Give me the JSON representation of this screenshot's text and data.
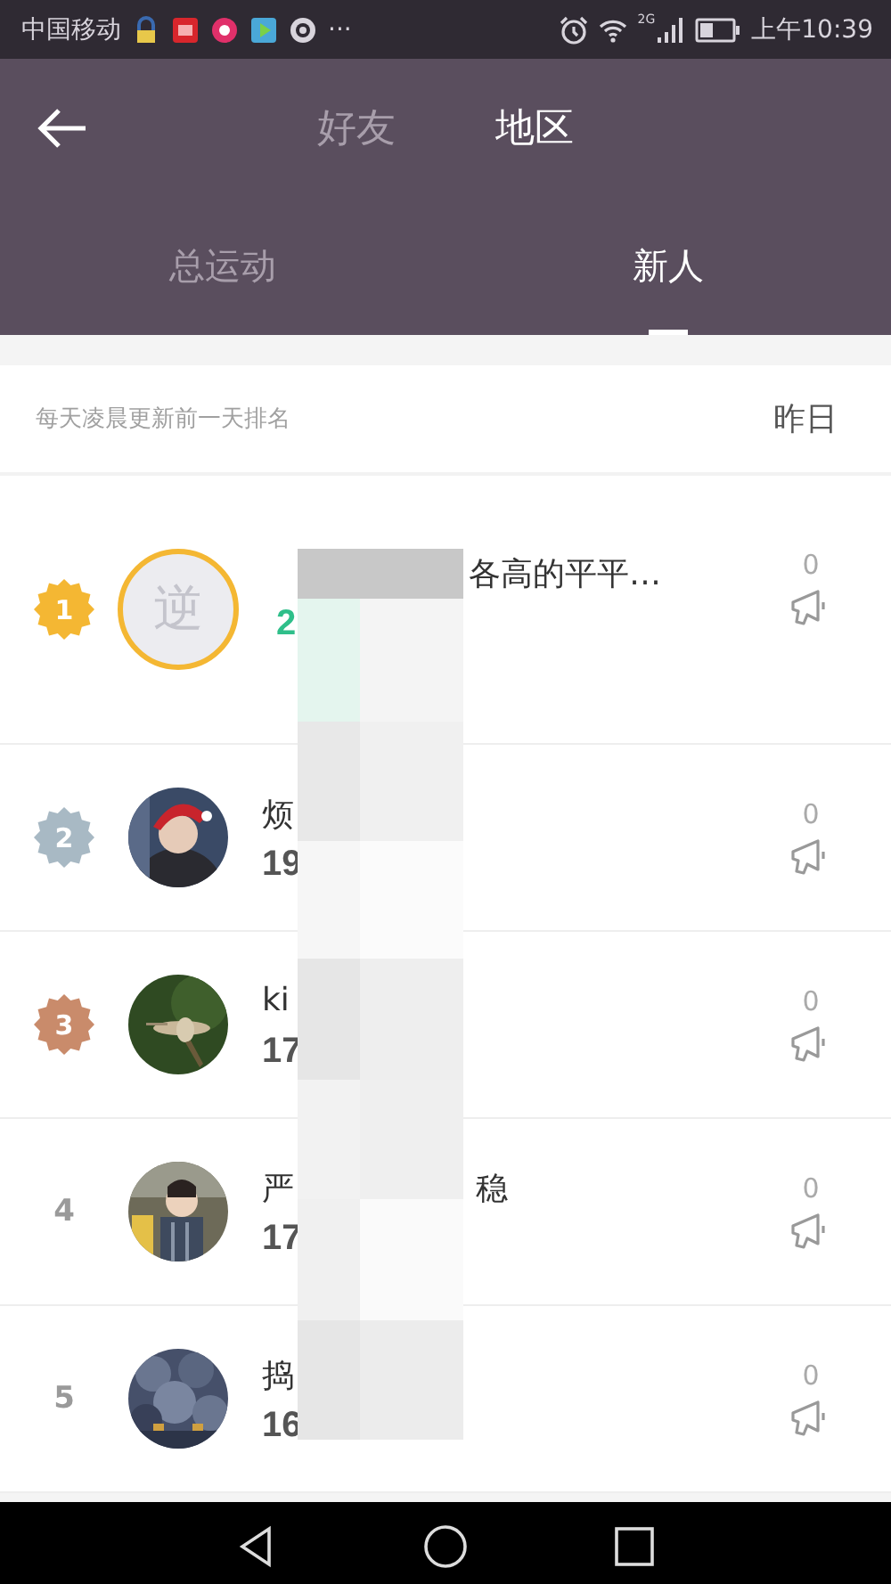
{
  "status_bar": {
    "carrier": "中国移动",
    "more": "···",
    "network": "2G",
    "time": "上午10:39"
  },
  "top_tabs": [
    {
      "label": "好友",
      "selected": false
    },
    {
      "label": "地区",
      "selected": true
    }
  ],
  "sub_tabs": [
    {
      "label": "总运动",
      "selected": false
    },
    {
      "label": "新人",
      "selected": true
    }
  ],
  "info_bar": {
    "note": "每天凌晨更新前一天排名",
    "period": "昨日"
  },
  "rows": [
    {
      "rank": "1",
      "kind": "badge",
      "color": "#f4b733",
      "avatar": {
        "kind": "text",
        "text": "逆"
      },
      "name_end": "各高的平平…",
      "score": "2",
      "likes": "0"
    },
    {
      "rank": "2",
      "kind": "badge",
      "color": "#a8b9c4",
      "name_start": "烦",
      "score": "19",
      "likes": "0"
    },
    {
      "rank": "3",
      "kind": "badge",
      "color": "#c98b6b",
      "name_start": "ki",
      "score": "17",
      "likes": "0"
    },
    {
      "rank": "4",
      "kind": "plain",
      "name_start": "严",
      "name_end": "稳",
      "score": "17",
      "likes": "0"
    },
    {
      "rank": "5",
      "kind": "plain",
      "name_start": "捣",
      "score": "16",
      "likes": "0"
    }
  ]
}
